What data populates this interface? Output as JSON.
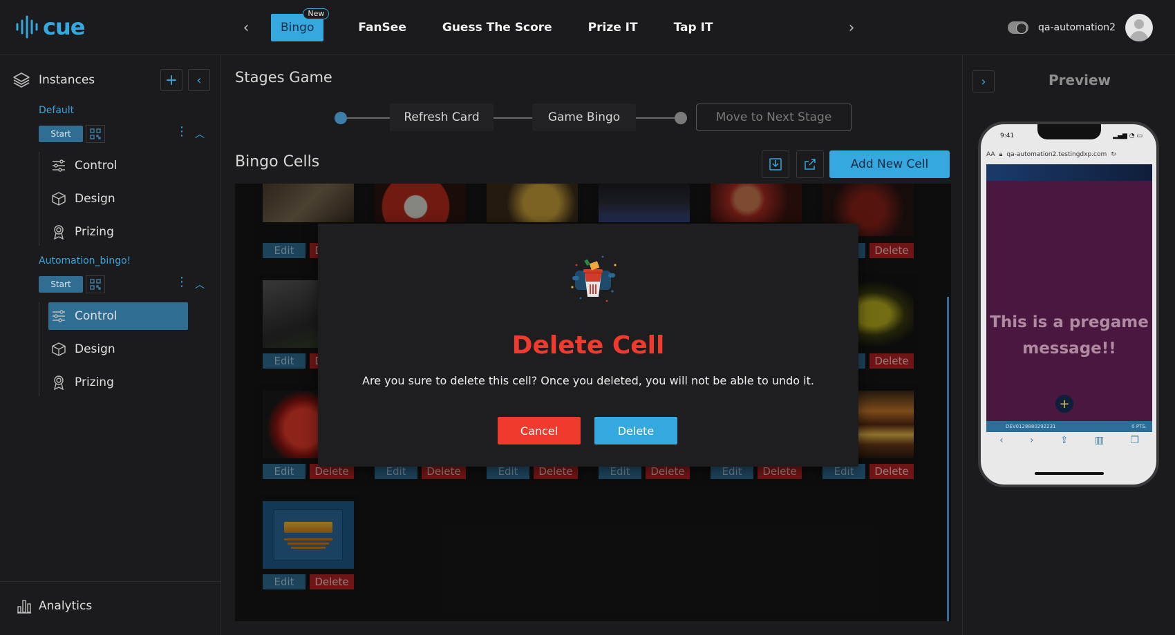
{
  "app": {
    "logo_text": "cue"
  },
  "nav": {
    "tabs": [
      {
        "label": "Bingo",
        "badge": "New"
      },
      {
        "label": "FanSee"
      },
      {
        "label": "Guess The Score"
      },
      {
        "label": "Prize IT"
      },
      {
        "label": "Tap IT"
      }
    ]
  },
  "user": {
    "name": "qa-automation2"
  },
  "sidebar": {
    "title": "Instances",
    "instances": [
      {
        "name": "Default",
        "start_label": "Start",
        "items": [
          "Control",
          "Design",
          "Prizing"
        ]
      },
      {
        "name": "Automation_bingo!",
        "start_label": "Start",
        "items": [
          "Control",
          "Design",
          "Prizing"
        ],
        "active_item": "Control"
      }
    ],
    "analytics_label": "Analytics"
  },
  "main": {
    "title": "Stages Game",
    "stages": [
      "Refresh Card",
      "Game Bingo"
    ],
    "next_stage_label": "Move to Next Stage",
    "cells_title": "Bingo Cells",
    "add_cell_label": "Add New Cell",
    "edit_label": "Edit",
    "delete_label": "Delete"
  },
  "modal": {
    "title": "Delete Cell",
    "message": "Are you sure to delete this cell? Once you deleted, you will not be able to undo it.",
    "cancel_label": "Cancel",
    "delete_label": "Delete"
  },
  "preview": {
    "title": "Preview",
    "time": "9:41",
    "aa": "AA",
    "url": "qa-automation2.testingdxp.com",
    "message": "This is a pregame message!!",
    "player_id": "DEV0128880292231",
    "points": "0 PTS."
  },
  "colors": {
    "accent": "#35a8e0",
    "danger": "#f03a2e",
    "start": "#2f6d93"
  }
}
